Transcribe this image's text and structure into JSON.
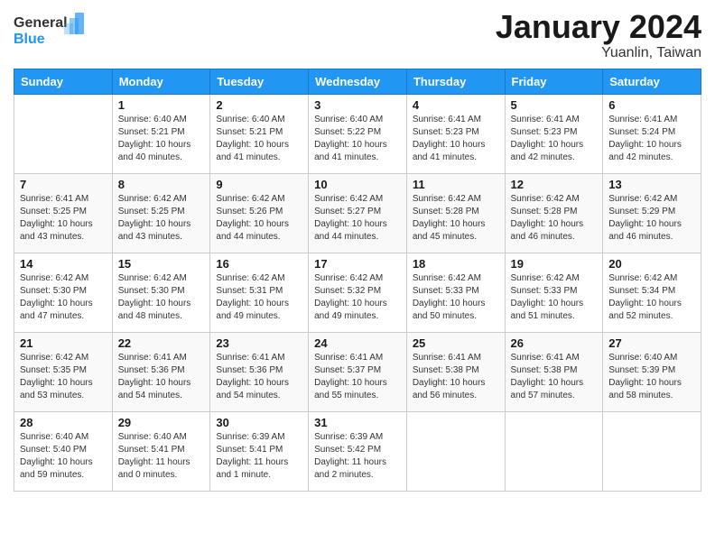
{
  "header": {
    "logo_line1": "General",
    "logo_line2": "Blue",
    "title": "January 2024",
    "subtitle": "Yuanlin, Taiwan"
  },
  "days_of_week": [
    "Sunday",
    "Monday",
    "Tuesday",
    "Wednesday",
    "Thursday",
    "Friday",
    "Saturday"
  ],
  "weeks": [
    [
      {
        "day": "",
        "sunrise": "",
        "sunset": "",
        "daylight": ""
      },
      {
        "day": "1",
        "sunrise": "Sunrise: 6:40 AM",
        "sunset": "Sunset: 5:21 PM",
        "daylight": "Daylight: 10 hours and 40 minutes."
      },
      {
        "day": "2",
        "sunrise": "Sunrise: 6:40 AM",
        "sunset": "Sunset: 5:21 PM",
        "daylight": "Daylight: 10 hours and 41 minutes."
      },
      {
        "day": "3",
        "sunrise": "Sunrise: 6:40 AM",
        "sunset": "Sunset: 5:22 PM",
        "daylight": "Daylight: 10 hours and 41 minutes."
      },
      {
        "day": "4",
        "sunrise": "Sunrise: 6:41 AM",
        "sunset": "Sunset: 5:23 PM",
        "daylight": "Daylight: 10 hours and 41 minutes."
      },
      {
        "day": "5",
        "sunrise": "Sunrise: 6:41 AM",
        "sunset": "Sunset: 5:23 PM",
        "daylight": "Daylight: 10 hours and 42 minutes."
      },
      {
        "day": "6",
        "sunrise": "Sunrise: 6:41 AM",
        "sunset": "Sunset: 5:24 PM",
        "daylight": "Daylight: 10 hours and 42 minutes."
      }
    ],
    [
      {
        "day": "7",
        "sunrise": "Sunrise: 6:41 AM",
        "sunset": "Sunset: 5:25 PM",
        "daylight": "Daylight: 10 hours and 43 minutes."
      },
      {
        "day": "8",
        "sunrise": "Sunrise: 6:42 AM",
        "sunset": "Sunset: 5:25 PM",
        "daylight": "Daylight: 10 hours and 43 minutes."
      },
      {
        "day": "9",
        "sunrise": "Sunrise: 6:42 AM",
        "sunset": "Sunset: 5:26 PM",
        "daylight": "Daylight: 10 hours and 44 minutes."
      },
      {
        "day": "10",
        "sunrise": "Sunrise: 6:42 AM",
        "sunset": "Sunset: 5:27 PM",
        "daylight": "Daylight: 10 hours and 44 minutes."
      },
      {
        "day": "11",
        "sunrise": "Sunrise: 6:42 AM",
        "sunset": "Sunset: 5:28 PM",
        "daylight": "Daylight: 10 hours and 45 minutes."
      },
      {
        "day": "12",
        "sunrise": "Sunrise: 6:42 AM",
        "sunset": "Sunset: 5:28 PM",
        "daylight": "Daylight: 10 hours and 46 minutes."
      },
      {
        "day": "13",
        "sunrise": "Sunrise: 6:42 AM",
        "sunset": "Sunset: 5:29 PM",
        "daylight": "Daylight: 10 hours and 46 minutes."
      }
    ],
    [
      {
        "day": "14",
        "sunrise": "Sunrise: 6:42 AM",
        "sunset": "Sunset: 5:30 PM",
        "daylight": "Daylight: 10 hours and 47 minutes."
      },
      {
        "day": "15",
        "sunrise": "Sunrise: 6:42 AM",
        "sunset": "Sunset: 5:30 PM",
        "daylight": "Daylight: 10 hours and 48 minutes."
      },
      {
        "day": "16",
        "sunrise": "Sunrise: 6:42 AM",
        "sunset": "Sunset: 5:31 PM",
        "daylight": "Daylight: 10 hours and 49 minutes."
      },
      {
        "day": "17",
        "sunrise": "Sunrise: 6:42 AM",
        "sunset": "Sunset: 5:32 PM",
        "daylight": "Daylight: 10 hours and 49 minutes."
      },
      {
        "day": "18",
        "sunrise": "Sunrise: 6:42 AM",
        "sunset": "Sunset: 5:33 PM",
        "daylight": "Daylight: 10 hours and 50 minutes."
      },
      {
        "day": "19",
        "sunrise": "Sunrise: 6:42 AM",
        "sunset": "Sunset: 5:33 PM",
        "daylight": "Daylight: 10 hours and 51 minutes."
      },
      {
        "day": "20",
        "sunrise": "Sunrise: 6:42 AM",
        "sunset": "Sunset: 5:34 PM",
        "daylight": "Daylight: 10 hours and 52 minutes."
      }
    ],
    [
      {
        "day": "21",
        "sunrise": "Sunrise: 6:42 AM",
        "sunset": "Sunset: 5:35 PM",
        "daylight": "Daylight: 10 hours and 53 minutes."
      },
      {
        "day": "22",
        "sunrise": "Sunrise: 6:41 AM",
        "sunset": "Sunset: 5:36 PM",
        "daylight": "Daylight: 10 hours and 54 minutes."
      },
      {
        "day": "23",
        "sunrise": "Sunrise: 6:41 AM",
        "sunset": "Sunset: 5:36 PM",
        "daylight": "Daylight: 10 hours and 54 minutes."
      },
      {
        "day": "24",
        "sunrise": "Sunrise: 6:41 AM",
        "sunset": "Sunset: 5:37 PM",
        "daylight": "Daylight: 10 hours and 55 minutes."
      },
      {
        "day": "25",
        "sunrise": "Sunrise: 6:41 AM",
        "sunset": "Sunset: 5:38 PM",
        "daylight": "Daylight: 10 hours and 56 minutes."
      },
      {
        "day": "26",
        "sunrise": "Sunrise: 6:41 AM",
        "sunset": "Sunset: 5:38 PM",
        "daylight": "Daylight: 10 hours and 57 minutes."
      },
      {
        "day": "27",
        "sunrise": "Sunrise: 6:40 AM",
        "sunset": "Sunset: 5:39 PM",
        "daylight": "Daylight: 10 hours and 58 minutes."
      }
    ],
    [
      {
        "day": "28",
        "sunrise": "Sunrise: 6:40 AM",
        "sunset": "Sunset: 5:40 PM",
        "daylight": "Daylight: 10 hours and 59 minutes."
      },
      {
        "day": "29",
        "sunrise": "Sunrise: 6:40 AM",
        "sunset": "Sunset: 5:41 PM",
        "daylight": "Daylight: 11 hours and 0 minutes."
      },
      {
        "day": "30",
        "sunrise": "Sunrise: 6:39 AM",
        "sunset": "Sunset: 5:41 PM",
        "daylight": "Daylight: 11 hours and 1 minute."
      },
      {
        "day": "31",
        "sunrise": "Sunrise: 6:39 AM",
        "sunset": "Sunset: 5:42 PM",
        "daylight": "Daylight: 11 hours and 2 minutes."
      },
      {
        "day": "",
        "sunrise": "",
        "sunset": "",
        "daylight": ""
      },
      {
        "day": "",
        "sunrise": "",
        "sunset": "",
        "daylight": ""
      },
      {
        "day": "",
        "sunrise": "",
        "sunset": "",
        "daylight": ""
      }
    ]
  ]
}
